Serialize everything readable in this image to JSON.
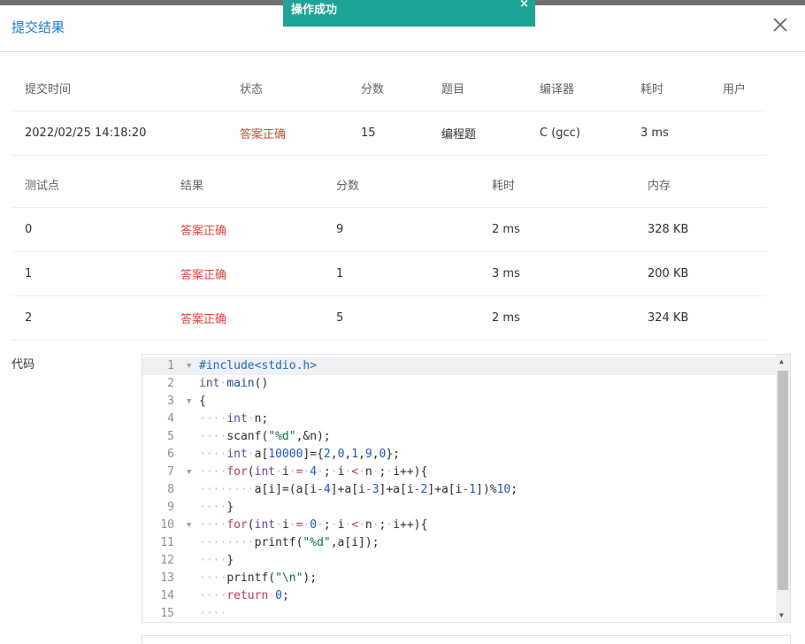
{
  "toast": {
    "message": "操作成功",
    "close": "×"
  },
  "dialog": {
    "title": "提交结果"
  },
  "summary": {
    "headers": [
      "提交时间",
      "状态",
      "分数",
      "题目",
      "编译器",
      "耗时",
      "用户"
    ],
    "row": {
      "time": "2022/02/25 14:18:20",
      "status": "答案正确",
      "score": "15",
      "problem": "编程题",
      "compiler": "C (gcc)",
      "duration": "3 ms",
      "user": ""
    }
  },
  "tests": {
    "headers": [
      "测试点",
      "结果",
      "分数",
      "耗时",
      "内存"
    ],
    "rows": [
      {
        "id": "0",
        "result": "答案正确",
        "score": "9",
        "time": "2 ms",
        "memory": "328 KB"
      },
      {
        "id": "1",
        "result": "答案正确",
        "score": "1",
        "time": "3 ms",
        "memory": "200 KB"
      },
      {
        "id": "2",
        "result": "答案正确",
        "score": "5",
        "time": "2 ms",
        "memory": "324 KB"
      }
    ]
  },
  "code": {
    "label": "代码",
    "lines": [
      "#include<stdio.h>",
      "int main()",
      "{",
      "    int n;",
      "    scanf(\"%d\",&n);",
      "    int a[10000]={2,0,1,9,0};",
      "    for(int i = 4 ; i < n ; i++){",
      "        a[i]=(a[i-4]+a[i-3]+a[i-2]+a[i-1])%10;",
      "    }",
      "    for(int i = 0 ; i < n ; i++){",
      "        printf(\"%d\",a[i]);",
      "    }",
      "    printf(\"\\n\");",
      "    return 0;",
      "    "
    ],
    "folds": [
      1,
      3,
      7,
      10
    ]
  },
  "colors": {
    "accent": "#1b7fd4",
    "toast": "#1aa595",
    "ok": "#e8443a"
  }
}
